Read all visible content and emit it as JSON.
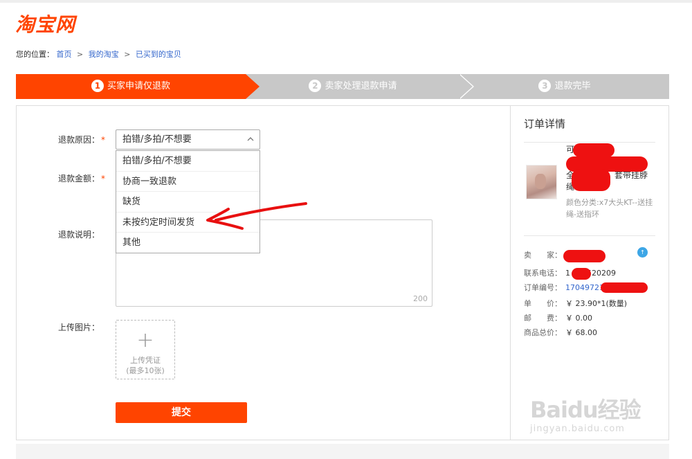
{
  "header": {
    "logo": "淘宝网",
    "breadcrumb": {
      "prefix": "您的位置：",
      "items": [
        "首页",
        "我的淘宝",
        "已买到的宝贝"
      ],
      "separator": ">"
    }
  },
  "steps": [
    {
      "num": "1",
      "label": "买家申请仅退款"
    },
    {
      "num": "2",
      "label": "卖家处理退款申请"
    },
    {
      "num": "3",
      "label": "退款完毕"
    }
  ],
  "form": {
    "reason_label": "退款原因：",
    "amount_label": "退款金额：",
    "description_label": "退款说明：",
    "upload_label": "上传图片：",
    "required_mark": "*",
    "selected_reason": "拍错/多拍/不想要",
    "reason_options": [
      "拍错/多拍/不想要",
      "协商一致退款",
      "缺货",
      "未按约定时间发货",
      "其他"
    ],
    "description_counter": "200",
    "upload_button": {
      "plus": "+",
      "line1": "上传凭证",
      "line2": "(最多10张)"
    },
    "submit_label": "提交"
  },
  "order": {
    "title": "订单详情",
    "product": {
      "name_line1": "可",
      "name_line2": "全",
      "name_line2_tail": "套带挂脖",
      "name_line3": "绳",
      "sku": "颜色分类:x7大头KT--送挂绳-送指环"
    },
    "seller_label": "卖　　家：",
    "phone_label": "联系电话：",
    "phone_value_prefix": "1",
    "phone_value_suffix": "520209",
    "order_no_label": "订单编号：",
    "order_no_value": "17049721",
    "unit_price_label": "单　　价：",
    "unit_price_value": "￥ 23.90*1(数量)",
    "shipping_label": "邮　　费：",
    "shipping_value": "￥ 0.00",
    "total_label": "商品总价：",
    "total_value": "￥ 68.00",
    "chat_icon_text": "↑"
  },
  "watermark": {
    "main": "Baidu经验",
    "sub": "jingyan.baidu.com"
  },
  "colors": {
    "accent": "#ff4400",
    "link": "#3366cc",
    "inactive_step": "#c8c8c8",
    "redaction": "#ee1111"
  }
}
